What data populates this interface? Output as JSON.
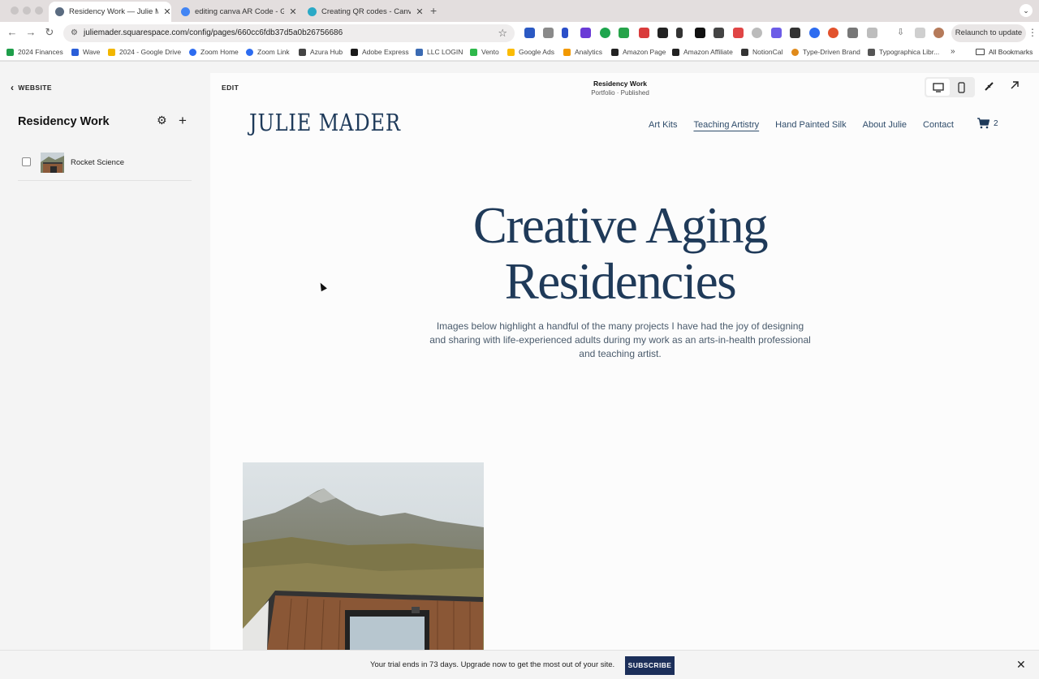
{
  "browser": {
    "tabs": [
      {
        "title": "Residency Work — Julie Mad",
        "active": true,
        "color": "#5a6b80"
      },
      {
        "title": "editing canva AR Code - Goo",
        "active": false,
        "color": "#4285f4"
      },
      {
        "title": "Creating QR codes - Canva H",
        "active": false,
        "color": "#2aa9c6"
      }
    ],
    "url": "juliemader.squarespace.com/config/pages/660cc6fdb37d5a0b26756686",
    "relaunch_label": "Relaunch to update",
    "bookmarks": [
      {
        "label": "2024 Finances",
        "color": "#1e9e4a"
      },
      {
        "label": "Wave",
        "color": "#2a5ed8"
      },
      {
        "label": "2024 - Google Drive",
        "color": "#f2b600"
      },
      {
        "label": "Zoom Home",
        "color": "#2d6cf0"
      },
      {
        "label": "Zoom Link",
        "color": "#2d6cf0"
      },
      {
        "label": "Azura Hub",
        "color": "#444444"
      },
      {
        "label": "Adobe Express",
        "color": "#1a1a1a"
      },
      {
        "label": "LLC LOGIN",
        "color": "#3b6bb3"
      },
      {
        "label": "Vento",
        "color": "#2eb84b"
      },
      {
        "label": "Google Ads",
        "color": "#fbbc04"
      },
      {
        "label": "Analytics",
        "color": "#f29900"
      },
      {
        "label": "Amazon Page",
        "color": "#222222"
      },
      {
        "label": "Amazon Affiliate",
        "color": "#222222"
      },
      {
        "label": "NotionCal",
        "color": "#333333"
      },
      {
        "label": "Type-Driven Brand",
        "color": "#e08a1a"
      },
      {
        "label": "Typographica Libr...",
        "color": "#555555"
      }
    ],
    "all_bookmarks_label": "All Bookmarks"
  },
  "sidebar": {
    "back_label": "WEBSITE",
    "title": "Residency Work",
    "items": [
      {
        "label": "Rocket Science"
      }
    ]
  },
  "editor": {
    "edit_label": "EDIT",
    "page_title": "Residency Work",
    "page_status": "Portfolio · Published"
  },
  "site": {
    "logo": "JULIE MADER",
    "nav": [
      "Art Kits",
      "Teaching Artistry",
      "Hand Painted Silk",
      "About Julie",
      "Contact"
    ],
    "nav_current": "Teaching Artistry",
    "cart_count": "2",
    "hero_line1": "Creative Aging",
    "hero_line2": "Residencies",
    "blurb": "Images below highlight a handful of the many projects I have had the joy of designing and sharing with life-experienced adults during my work as an arts-in-health professional and teaching artist.",
    "brand_color": "#1f3a59"
  },
  "banner": {
    "message": "Your trial ends in 73 days. Upgrade now to get the most out of your site.",
    "subscribe_label": "SUBSCRIBE"
  }
}
